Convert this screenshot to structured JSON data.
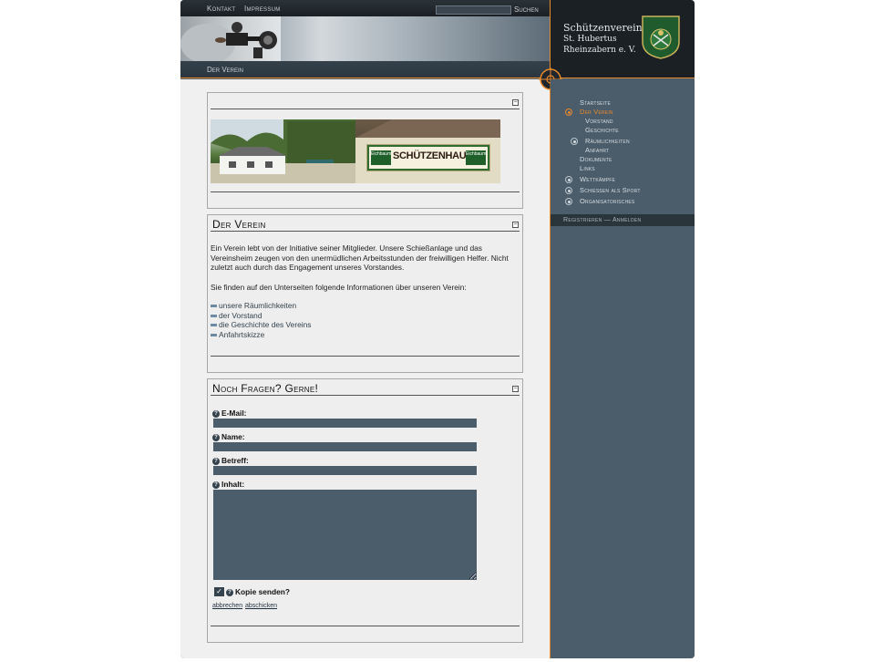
{
  "topnav": {
    "kontakt": "Kontakt",
    "impressum": "Impressum",
    "search_placeholder": "",
    "search_button": "Suchen"
  },
  "breadcrumb": "Der Verein",
  "club": {
    "line1": "Schützenverein",
    "line2": "St. Hubertus",
    "line3": "Rheinzabern e. V.",
    "crest_text": "Schützenverein",
    "crest_icon": "club-crest"
  },
  "box1": {
    "title": "",
    "sign_text": "SCHÜTZENHAUS",
    "sign_logo": "Eichbaum"
  },
  "box2": {
    "title": "Der Verein",
    "intro": "Ein Verein lebt von der Initiative seiner Mitglieder. Unsere Schießanlage und das Vereinsheim zeugen von den unermüdlichen Arbeitsstunden der freiwilligen Helfer. Nicht zuletzt auch durch das Engagement unseres Vorstandes.",
    "lead": "Sie finden auf den Unterseiten folgende Informationen über unseren Verein:",
    "links": [
      "unsere Räumlichkeiten",
      "der Vorstand",
      "die Geschichte des Vereins",
      "Anfahrtskizze"
    ]
  },
  "box3": {
    "title": "Noch Fragen? Gerne!",
    "email_label": "E-Mail:",
    "name_label": "Name:",
    "betreff_label": "Betreff:",
    "inhalt_label": "Inhalt:",
    "copy_label": "Kopie senden?",
    "cancel": "abbrechen",
    "submit": "abschicken"
  },
  "sidebar": {
    "nav": {
      "startseite": "Startseite",
      "der_verein": "Der Verein",
      "vorstand": "Vorstand",
      "geschichte": "Geschichte",
      "raeumlichkeiten": "Räumlichkeiten",
      "anfahrt": "Anfahrt",
      "dokumente": "Dokumente",
      "links": "Links",
      "wettkaempfe": "Wettkämpfe",
      "schiessen": "Schießen als Sport",
      "organisatorisches": "Organisatorisches"
    },
    "login": "Registrieren — Anmelden"
  },
  "colors": {
    "accent": "#e8892b",
    "sidebar": "#4b5d6b",
    "content": "#f0f0f0"
  }
}
